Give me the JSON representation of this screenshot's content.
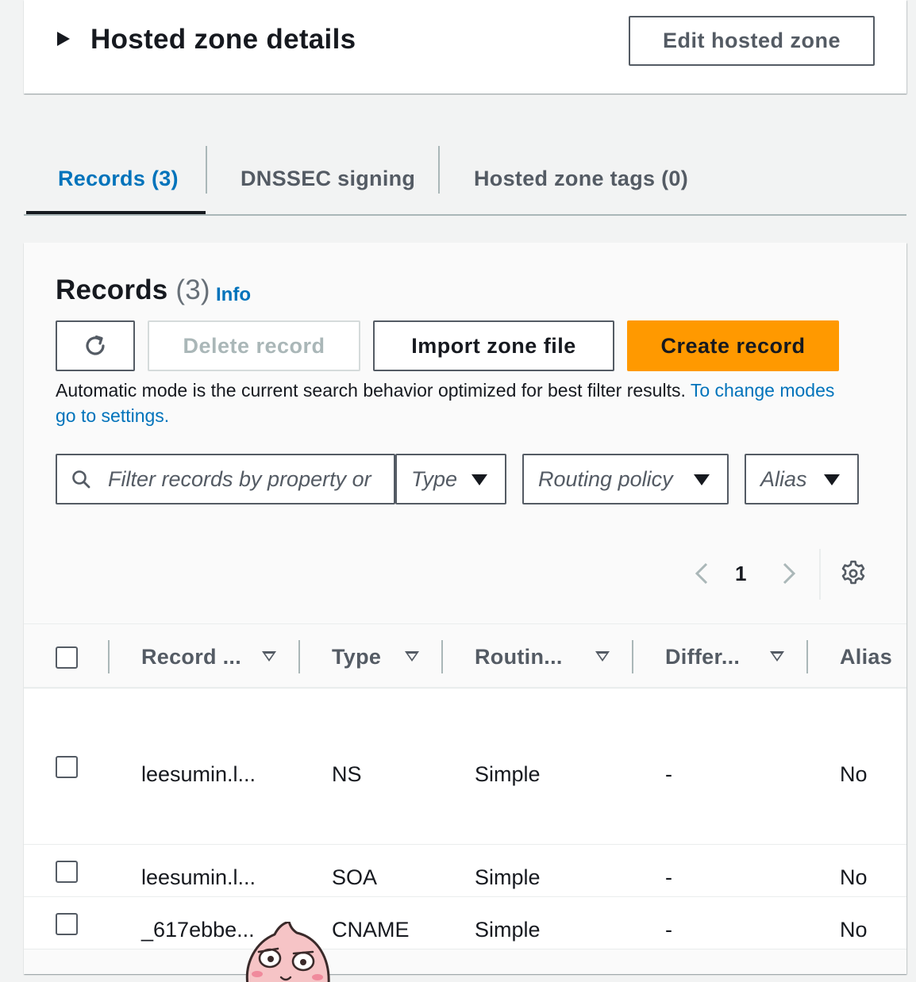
{
  "zone_panel": {
    "title": "Hosted zone details",
    "edit_button": "Edit hosted zone"
  },
  "tabs": [
    {
      "label": "Records (3)",
      "active": true
    },
    {
      "label": "DNSSEC signing",
      "active": false
    },
    {
      "label": "Hosted zone tags (0)",
      "active": false
    }
  ],
  "records": {
    "title": "Records",
    "count": "(3)",
    "info_link": "Info",
    "buttons": {
      "delete": "Delete record",
      "import": "Import zone file",
      "create": "Create record"
    },
    "auto_mode_text": "Automatic mode is the current search behavior optimized for best filter results. ",
    "auto_mode_link": "To change modes go to settings.",
    "search_placeholder": "Filter records by property or",
    "filters": {
      "type": "Type",
      "routing": "Routing policy",
      "alias": "Alias"
    },
    "pagination": {
      "page": "1"
    },
    "columns": [
      "Record ...",
      "Type",
      "Routin...",
      "Differ...",
      "Alias"
    ],
    "rows": [
      {
        "name": "leesumin.l...",
        "type": "NS",
        "routing": "Simple",
        "differ": "-",
        "alias": "No"
      },
      {
        "name": "leesumin.l...",
        "type": "SOA",
        "routing": "Simple",
        "differ": "-",
        "alias": "No"
      },
      {
        "name": "_617ebbe...",
        "type": "CNAME",
        "routing": "Simple",
        "differ": "-",
        "alias": "No"
      }
    ]
  },
  "colors": {
    "accent": "#0073bb",
    "primary_button": "#ff9900",
    "text": "#16191f",
    "muted": "#545b64"
  },
  "icons": [
    "caret-right-icon",
    "refresh-icon",
    "search-icon",
    "dropdown-arrow-icon",
    "chevron-left-icon",
    "chevron-right-icon",
    "settings-gear-icon",
    "sort-icon",
    "peach-mascot-icon"
  ]
}
